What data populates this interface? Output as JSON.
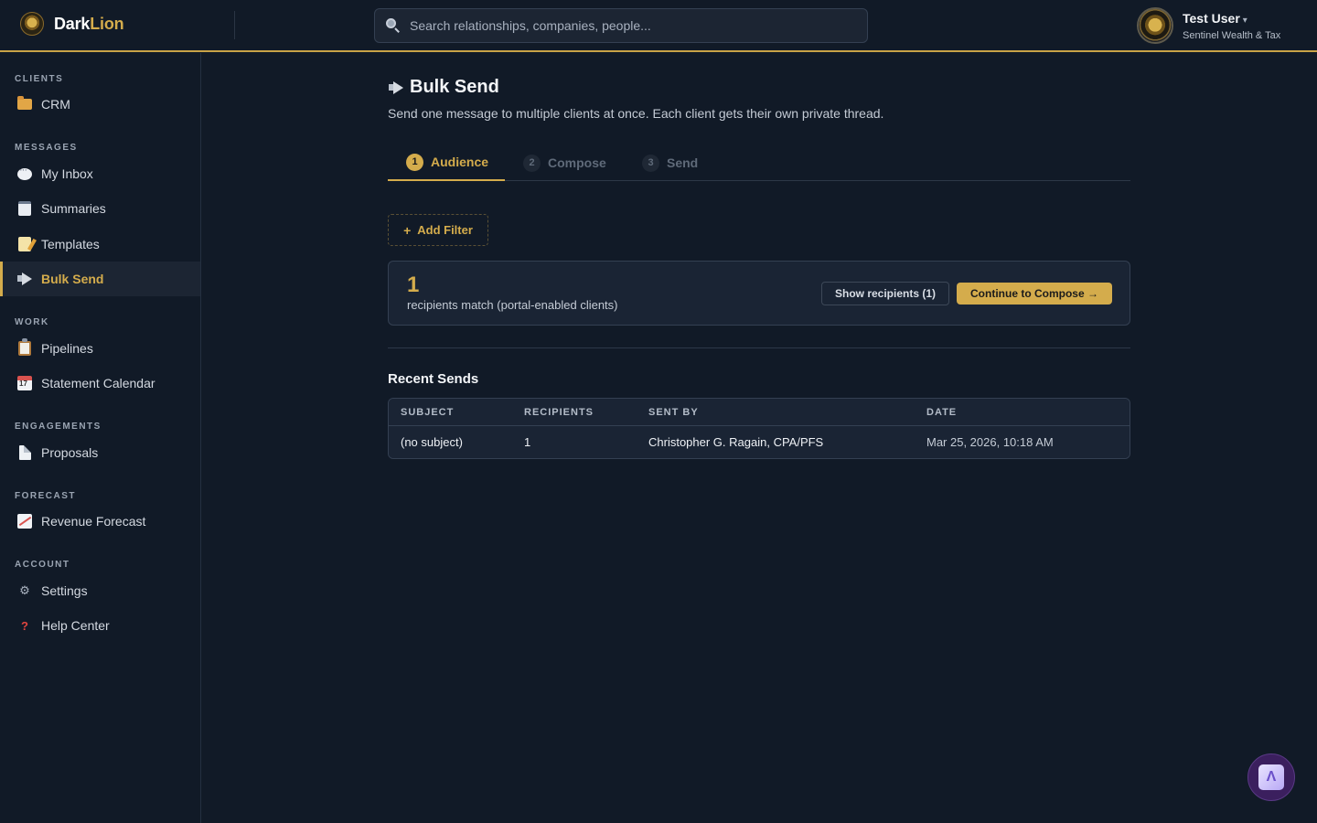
{
  "brand": {
    "name_part1": "Dark",
    "name_part2": "Lion"
  },
  "search": {
    "placeholder": "Search relationships, companies, people..."
  },
  "user": {
    "name": "Test User",
    "caret": "▾",
    "org": "Sentinel Wealth & Tax"
  },
  "sidebar": {
    "sections": [
      {
        "label": "CLIENTS",
        "items": [
          {
            "label": "CRM",
            "icon": "folder-icon"
          }
        ]
      },
      {
        "label": "MESSAGES",
        "items": [
          {
            "label": "My Inbox",
            "icon": "chat-bubble-icon"
          },
          {
            "label": "Summaries",
            "icon": "notepad-icon"
          },
          {
            "label": "Templates",
            "icon": "memo-icon"
          },
          {
            "label": "Bulk Send",
            "icon": "megaphone-icon",
            "active": true
          }
        ]
      },
      {
        "label": "WORK",
        "items": [
          {
            "label": "Pipelines",
            "icon": "clipboard-icon"
          },
          {
            "label": "Statement Calendar",
            "icon": "calendar-icon"
          }
        ]
      },
      {
        "label": "ENGAGEMENTS",
        "items": [
          {
            "label": "Proposals",
            "icon": "document-icon"
          }
        ]
      },
      {
        "label": "FORECAST",
        "items": [
          {
            "label": "Revenue Forecast",
            "icon": "chart-increasing-icon"
          }
        ]
      },
      {
        "label": "ACCOUNT",
        "items": [
          {
            "label": "Settings",
            "icon": "gear-icon"
          },
          {
            "label": "Help Center",
            "icon": "question-mark-icon"
          }
        ]
      }
    ]
  },
  "page": {
    "title": "Bulk Send",
    "subtitle": "Send one message to multiple clients at once. Each client gets their own private thread."
  },
  "steps": [
    {
      "num": "1",
      "label": "Audience",
      "active": true
    },
    {
      "num": "2",
      "label": "Compose",
      "active": false
    },
    {
      "num": "3",
      "label": "Send",
      "active": false
    }
  ],
  "filter": {
    "plus": "+",
    "label": "Add Filter"
  },
  "match": {
    "count": "1",
    "label": "recipients match (portal-enabled clients)",
    "show_label": "Show recipients (1)",
    "continue_label": "Continue to Compose →"
  },
  "recent": {
    "title": "Recent Sends",
    "columns": [
      "SUBJECT",
      "RECIPIENTS",
      "SENT BY",
      "DATE"
    ],
    "rows": [
      {
        "subject": "(no subject)",
        "recipients": "1",
        "sent_by": "Christopher G. Ragain, CPA/PFS",
        "date": "Mar 25, 2026, 10:18 AM"
      }
    ]
  },
  "assistant": {
    "glyph": "Λ"
  },
  "colors": {
    "accent": "#d4ac4c",
    "background": "#111a27",
    "card": "#1a2434"
  }
}
